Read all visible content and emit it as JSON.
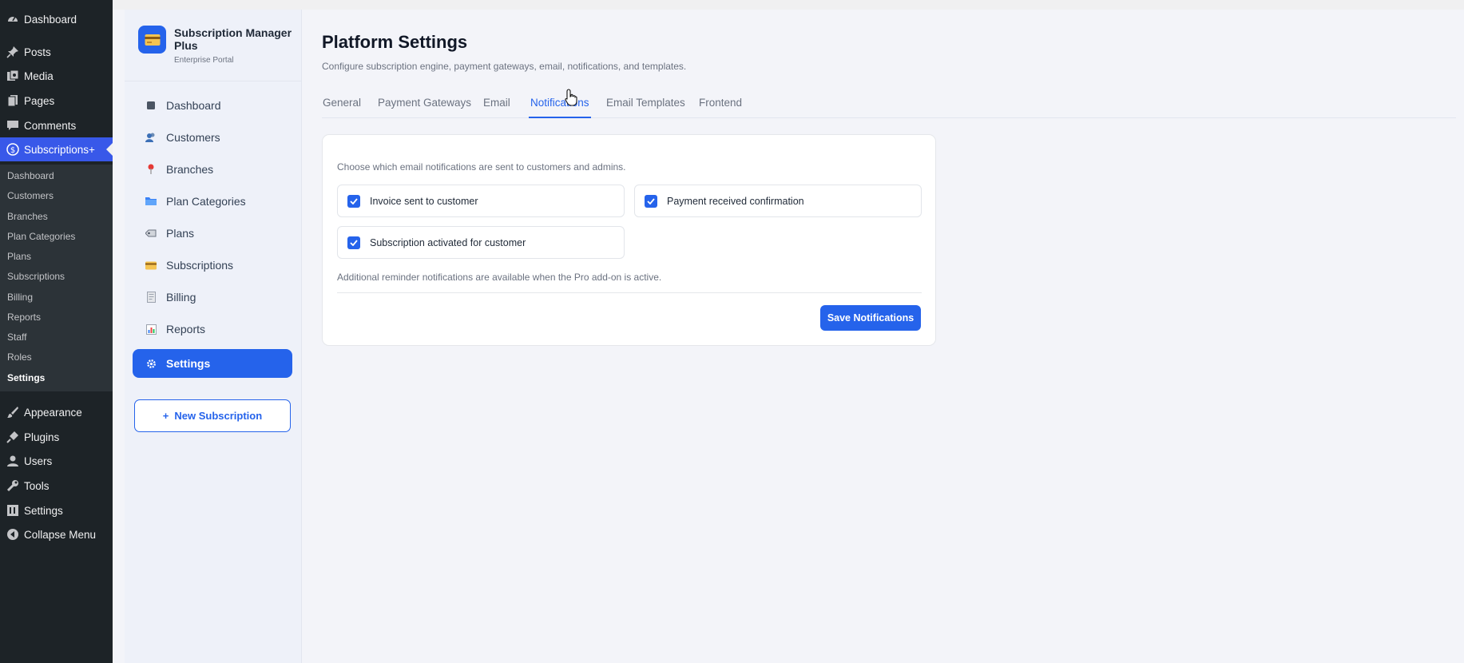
{
  "wp_menu": {
    "items": [
      {
        "label": "Dashboard",
        "icon": "gauge-icon"
      },
      {
        "label": "Posts",
        "icon": "pin-icon"
      },
      {
        "label": "Media",
        "icon": "media-icon"
      },
      {
        "label": "Pages",
        "icon": "page-icon"
      },
      {
        "label": "Comments",
        "icon": "comment-icon"
      },
      {
        "label": "Subscriptions+",
        "icon": "dollar-icon"
      },
      {
        "label": "Appearance",
        "icon": "brush-icon"
      },
      {
        "label": "Plugins",
        "icon": "plug-icon"
      },
      {
        "label": "Users",
        "icon": "user-icon"
      },
      {
        "label": "Tools",
        "icon": "wrench-icon"
      },
      {
        "label": "Settings",
        "icon": "settings-icon"
      },
      {
        "label": "Collapse Menu",
        "icon": "collapse-icon"
      }
    ],
    "submenu": [
      "Dashboard",
      "Customers",
      "Branches",
      "Plan Categories",
      "Plans",
      "Subscriptions",
      "Billing",
      "Reports",
      "Staff",
      "Roles",
      "Settings"
    ]
  },
  "brand": {
    "name": "Subscription Manager Plus",
    "subtitle": "Enterprise Portal"
  },
  "plugin_nav": [
    {
      "label": "Dashboard",
      "icon": "dashboard-square-icon"
    },
    {
      "label": "Customers",
      "icon": "customers-icon"
    },
    {
      "label": "Branches",
      "icon": "pushpin-icon"
    },
    {
      "label": "Plan Categories",
      "icon": "folder-icon"
    },
    {
      "label": "Plans",
      "icon": "tag-icon"
    },
    {
      "label": "Subscriptions",
      "icon": "credit-card-icon"
    },
    {
      "label": "Billing",
      "icon": "receipt-icon"
    },
    {
      "label": "Reports",
      "icon": "bar-chart-icon"
    },
    {
      "label": "Settings",
      "icon": "gear-icon"
    }
  ],
  "new_subscription": {
    "plus": "+",
    "label": "New Subscription"
  },
  "page": {
    "title": "Platform Settings",
    "description": "Configure subscription engine, payment gateways, email, notifications, and templates."
  },
  "tabs": [
    "General",
    "Payment Gateways",
    "Email",
    "Notifications",
    "Email Templates",
    "Frontend"
  ],
  "active_tab": "Notifications",
  "notifications": {
    "description": "Choose which email notifications are sent to customers and admins.",
    "options": [
      {
        "label": "Invoice sent to customer",
        "checked": true
      },
      {
        "label": "Payment received confirmation",
        "checked": true
      },
      {
        "label": "Subscription activated for customer",
        "checked": true
      }
    ],
    "note": "Additional reminder notifications are available when the Pro add-on is active.",
    "save_label": "Save Notifications"
  },
  "colors": {
    "accent": "#2563eb",
    "wp_sidebar": "#1d2327",
    "wp_active": "#3858e9"
  }
}
